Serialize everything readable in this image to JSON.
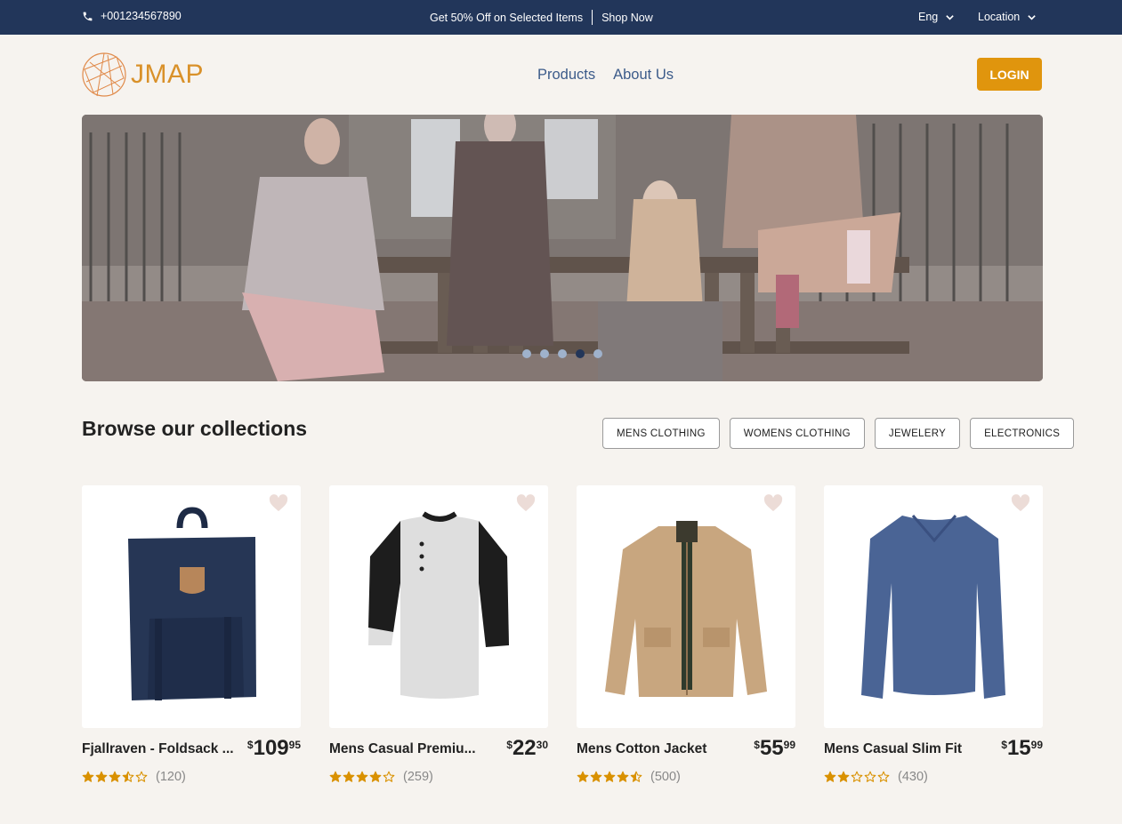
{
  "topbar": {
    "phone": "+001234567890",
    "promo": "Get 50% Off on Selected Items",
    "promo_link": "Shop Now",
    "language": "Eng",
    "location": "Location"
  },
  "header": {
    "logo": "JMAP",
    "nav": [
      "Products",
      "About Us"
    ],
    "login": "LOGIN"
  },
  "hero": {
    "slide_count": 5,
    "active_slide": 4
  },
  "collections": {
    "title": "Browse our collections",
    "filters": [
      "MENS CLOTHING",
      "WOMENS CLOTHING",
      "JEWELERY",
      "ELECTRONICS"
    ]
  },
  "products": [
    {
      "title": "Fjallraven - Foldsack ...",
      "currency": "$",
      "price_whole": "109",
      "price_cents": "95",
      "rating": 3.5,
      "count": "(120)",
      "image": "backpack"
    },
    {
      "title": "Mens Casual Premiu...",
      "currency": "$",
      "price_whole": "22",
      "price_cents": "30",
      "rating": 4,
      "count": "(259)",
      "image": "raglan-shirt"
    },
    {
      "title": "Mens Cotton Jacket",
      "currency": "$",
      "price_whole": "55",
      "price_cents": "99",
      "rating": 4.5,
      "count": "(500)",
      "image": "jacket"
    },
    {
      "title": "Mens Casual Slim Fit",
      "currency": "$",
      "price_whole": "15",
      "price_cents": "99",
      "rating": 2,
      "count": "(430)",
      "image": "long-sleeve-tee"
    }
  ],
  "colors": {
    "topbar": "#22365a",
    "accent": "#e0950d",
    "nav": "#3c5b8a",
    "star": "#d99100",
    "background": "#f6f3ef"
  }
}
